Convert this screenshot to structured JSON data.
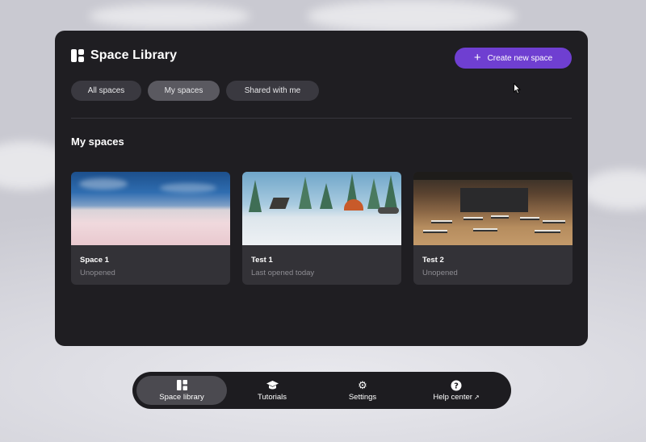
{
  "library": {
    "title": "Space Library",
    "create_label": "Create new space",
    "tabs": [
      {
        "label": "All spaces",
        "active": false
      },
      {
        "label": "My spaces",
        "active": true
      },
      {
        "label": "Shared with me",
        "active": false
      }
    ],
    "section_title": "My spaces",
    "spaces": [
      {
        "name": "Space 1",
        "status": "Unopened"
      },
      {
        "name": "Test 1",
        "status": "Last opened today"
      },
      {
        "name": "Test 2",
        "status": "Unopened"
      }
    ]
  },
  "bottom_nav": {
    "items": [
      {
        "label": "Space library",
        "icon": "space-library-icon",
        "active": true
      },
      {
        "label": "Tutorials",
        "icon": "graduation-cap-icon",
        "active": false
      },
      {
        "label": "Settings",
        "icon": "gear-icon",
        "active": false
      },
      {
        "label": "Help center",
        "icon": "help-icon",
        "active": false,
        "external": true
      }
    ]
  },
  "colors": {
    "accent": "#6f3fd1",
    "panel": "#1f1e22",
    "card": "#333237"
  }
}
